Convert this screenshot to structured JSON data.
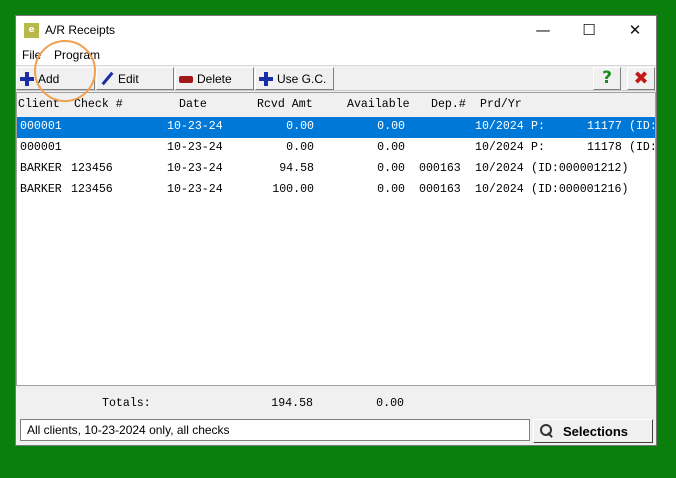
{
  "window": {
    "title": "A/R Receipts",
    "app_icon": "e",
    "controls": {
      "minimize": "—",
      "maximize": "☐",
      "close": "✕"
    }
  },
  "menu": [
    "File",
    "Program"
  ],
  "toolbar": {
    "add_label": "Add",
    "edit_label": "Edit",
    "delete_label": "Delete",
    "use_gc_label": "Use G.C.",
    "help_label": "?",
    "exit_label": "✖"
  },
  "grid": {
    "columns": [
      "Client",
      "Check #",
      "Date",
      "Rcvd Amt",
      "Available",
      "Dep.#",
      "Prd/Yr"
    ],
    "rows": [
      {
        "client": "000001",
        "check": "",
        "date": "10-23-24",
        "rcvd": "0.00",
        "available": "0.00",
        "dep": "",
        "prd": "10/2024",
        "ref": "P:",
        "num": "11177",
        "id": "(ID:",
        "selected": true
      },
      {
        "client": "000001",
        "check": "",
        "date": "10-23-24",
        "rcvd": "0.00",
        "available": "0.00",
        "dep": "",
        "prd": "10/2024",
        "ref": "P:",
        "num": "11178",
        "id": "(ID:",
        "selected": false
      },
      {
        "client": "BARKER",
        "check": "123456",
        "date": "10-23-24",
        "rcvd": "94.58",
        "available": "0.00",
        "dep": "000163",
        "prd": "10/2024",
        "ref": "(ID:000001212)",
        "num": "",
        "id": "",
        "selected": false
      },
      {
        "client": "BARKER",
        "check": "123456",
        "date": "10-23-24",
        "rcvd": "100.00",
        "available": "0.00",
        "dep": "000163",
        "prd": "10/2024",
        "ref": "(ID:000001216)",
        "num": "",
        "id": "",
        "selected": false
      }
    ]
  },
  "totals": {
    "label": "Totals:",
    "rcvd": "194.58",
    "available": "0.00"
  },
  "status": {
    "text": "All clients, 10-23-2024 only, all checks"
  },
  "selections_label": "Selections",
  "colors": {
    "background": "#0b7f0b",
    "selection": "#0078d7",
    "highlight": "#f0a050"
  }
}
